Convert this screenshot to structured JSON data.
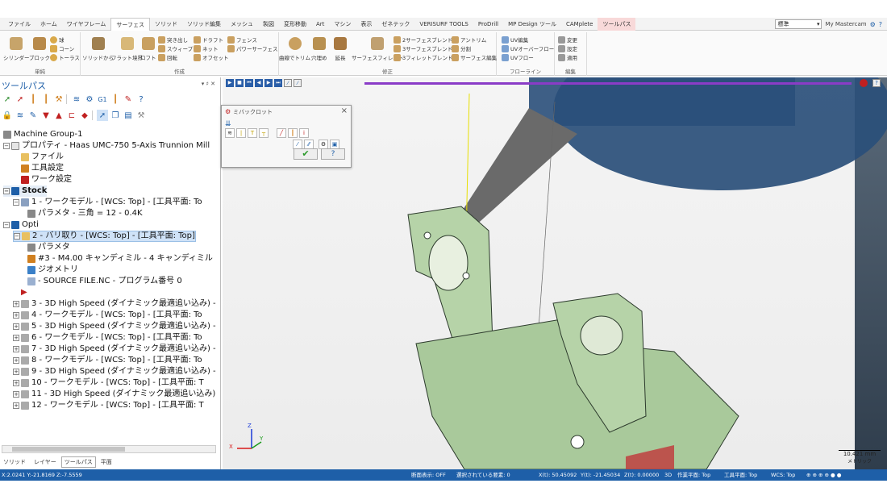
{
  "tabs": [
    "ファイル",
    "ホーム",
    "ワイヤフレーム",
    "サーフェス",
    "ソリッド",
    "ソリッド編集",
    "メッシュ",
    "製図",
    "変形移動",
    "Art",
    "マシン",
    "表示",
    "ゼネテック",
    "VERISURF TOOLS",
    "ProDrill",
    "MP Design ツール",
    "CAMplete",
    "ツールパス"
  ],
  "active_tab": "サーフェス",
  "context_tab": "ツールパス",
  "top_right": {
    "view_select": "標準",
    "account": "My Mastercam"
  },
  "ribbon": {
    "groups": {
      "simple": "単純",
      "create": "作成",
      "modify": "修正",
      "flowline": "フローライン",
      "edit": "編集"
    },
    "buttons": {
      "cylinder": "シリンダー",
      "block": "ブロック",
      "sphere": "球",
      "cone": "コーン",
      "torus": "トーラス",
      "from_solid": "ソリッドから",
      "flat_boundary": "フラット境界",
      "loft": "ロフト",
      "extrude": "突き出し",
      "sweep": "スウィープ",
      "revolve": "回転",
      "draft": "ドラフト",
      "net": "ネット",
      "offset": "オフセット",
      "fence": "フェンス",
      "power_surface": "パワーサーフェス",
      "trim_to_curve": "曲線でトリム",
      "fill_holes": "穴埋め",
      "extend": "延長",
      "surface_fillet": "サーフェスフィレット",
      "two_surface_blend": "2サーフェスブレンド",
      "three_surface_blend": "3サーフェスブレンド",
      "three_fillet_blend": "3フィレットブレンド",
      "untrim": "アントリム",
      "split": "分割",
      "surface_repair": "サーフェス編集",
      "uv_edit": "UV編集",
      "uv_overflow": "UVオーバーフロー",
      "uv_flow": "UVフロー",
      "change": "変更",
      "settings": "設定",
      "apply": "適用"
    }
  },
  "left_panel": {
    "title": "ツールパス",
    "controls": "▾ ♯ ✕",
    "tree": {
      "machine_group": "Machine Group-1",
      "properties": "プロパティ - Haas UMC-750 5-Axis Trunnion Mill",
      "files": "ファイル",
      "tool_settings": "工具設定",
      "work_settings": "ワーク設定",
      "stock": "Stock",
      "op1": "1 - ワークモデル - [WCS: Top] - [工具平面: To",
      "op1_param": "パラメタ - 三角 = 12 - 0.4K",
      "opti": "Opti",
      "op2": "2 - バリ取り - [WCS: Top] - [工具平面: Top]",
      "op2_params": "パラメタ",
      "op2_tool": "#3 - M4.00 キャンディミル - 4 キャンディミル",
      "op2_geometry": "ジオメトリ",
      "op2_source": "- SOURCE FILE.NC - プログラム番号 0",
      "op3": "3 - 3D High Speed (ダイナミック最適追い込み) -",
      "op4": "4 - ワークモデル - [WCS: Top] - [工具平面: To",
      "op5": "5 - 3D High Speed (ダイナミック最適追い込み) -",
      "op6": "6 - ワークモデル - [WCS: Top] - [工具平面: To",
      "op7": "7 - 3D High Speed (ダイナミック最適追い込み) -",
      "op8": "8 - ワークモデル - [WCS: Top] - [工具平面: To",
      "op9": "9 - 3D High Speed (ダイナミック最適追い込み) -",
      "op10": "10 - ワークモデル - [WCS: Top] - [工具平面: T",
      "op11": "11 - 3D High Speed (ダイナミック最適追い込み) -",
      "op12": "12 - ワークモデル - [WCS: Top] - [工具平面: T"
    },
    "bottom_tabs": [
      "ソリッド",
      "レイヤー",
      "ツールパス",
      "平面"
    ],
    "active_bottom_tab": "ツールパス"
  },
  "dialog": {
    "title": "ミバックロット",
    "ok": "✔",
    "help": "?"
  },
  "viewport": {
    "scale_value": "10.421 mm",
    "scale_unit": "メトリック",
    "axis_z": "Z",
    "axis_x": "X",
    "axis_y": "Y"
  },
  "statusbar": {
    "coords_left": "X:2.0241  Y:-21.8169  Z:-7.5559",
    "section": "断面表示: OFF",
    "selected": "選択されている要素: 0",
    "x": "X(t): 50.45092",
    "y": "Y(t): -21.45034",
    "z": "Z(t): 0.00000",
    "mode": "3D",
    "cplane": "作業平面: Top",
    "tplane": "工具平面: Top",
    "wcs": "WCS: Top"
  },
  "colors": {
    "accent": "#1e5fa8",
    "part_green": "#b6d3a8",
    "progress": "#8a3cc7",
    "holder": "#2a4f7a"
  }
}
